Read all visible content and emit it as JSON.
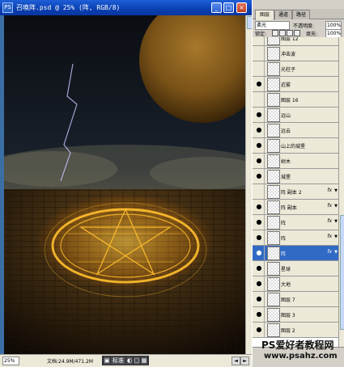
{
  "document": {
    "title": "召唤阵.psd @ 25% (阵, RGB/8)",
    "ps_icon": "PS",
    "buttons": {
      "minimize": "_",
      "maximize": "□",
      "close": "×"
    },
    "status": {
      "zoom": "25%",
      "doc_info": "文档:24.9M/471.2M",
      "mode_label": "标准"
    },
    "arrows": {
      "left": "◄",
      "right": "►"
    }
  },
  "layers_panel": {
    "tabs": [
      "图层",
      "通道",
      "路径"
    ],
    "blend_mode": "柔光",
    "opacity_label": "不透明度:",
    "opacity_value": "100%",
    "lock_label": "锁定:",
    "fill_label": "填充:",
    "fill_value": "100%",
    "layers": [
      {
        "name": "图层 12",
        "visible": false,
        "fx": false,
        "selected": false
      },
      {
        "name": "冲击波",
        "visible": false,
        "fx": false,
        "selected": false
      },
      {
        "name": "光柱子",
        "visible": false,
        "fx": false,
        "selected": false
      },
      {
        "name": "近雾",
        "visible": true,
        "fx": false,
        "selected": false
      },
      {
        "name": "图层 16",
        "visible": false,
        "fx": false,
        "selected": false
      },
      {
        "name": "远山",
        "visible": true,
        "fx": false,
        "selected": false
      },
      {
        "name": "远云",
        "visible": true,
        "fx": false,
        "selected": false
      },
      {
        "name": "山上的城堡",
        "visible": true,
        "fx": false,
        "selected": false
      },
      {
        "name": "树木",
        "visible": true,
        "fx": false,
        "selected": false
      },
      {
        "name": "城堡",
        "visible": true,
        "fx": false,
        "selected": false
      },
      {
        "name": "阵 副本 2",
        "visible": false,
        "fx": true,
        "selected": false
      },
      {
        "name": "阵 副本",
        "visible": true,
        "fx": true,
        "selected": false
      },
      {
        "name": "阵",
        "visible": true,
        "fx": true,
        "selected": false
      },
      {
        "name": "阵",
        "visible": true,
        "fx": true,
        "selected": false
      },
      {
        "name": "阵",
        "visible": true,
        "fx": true,
        "selected": true
      },
      {
        "name": "星球",
        "visible": true,
        "fx": false,
        "selected": false
      },
      {
        "name": "大地",
        "visible": true,
        "fx": false,
        "selected": false
      },
      {
        "name": "图层 7",
        "visible": true,
        "fx": false,
        "selected": false
      },
      {
        "name": "图层 3",
        "visible": true,
        "fx": false,
        "selected": false
      },
      {
        "name": "图层 2",
        "visible": true,
        "fx": false,
        "selected": false
      }
    ],
    "fx_label": "fx",
    "eye_icon": "●"
  },
  "watermark": {
    "line1": "PS爱好者教程网",
    "line2": "www.psahz.com"
  }
}
